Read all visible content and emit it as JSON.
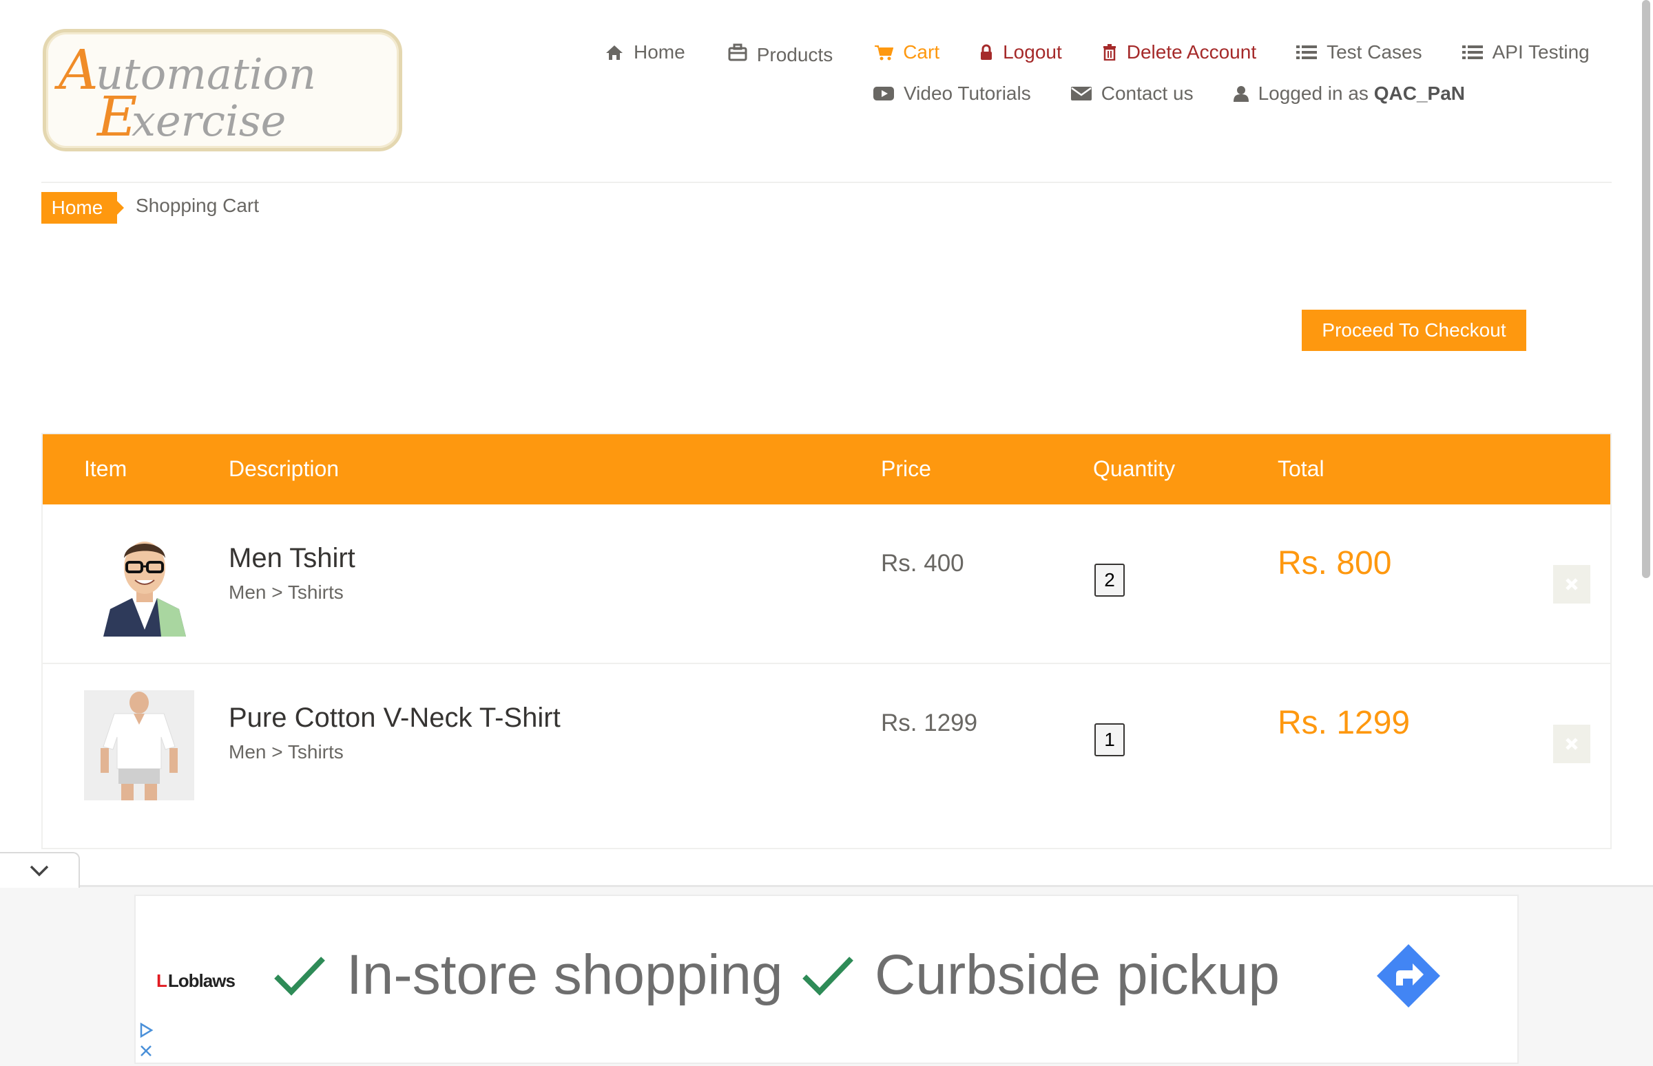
{
  "logo": {
    "line1": "Automation",
    "line2": "Exercise"
  },
  "nav": {
    "row1": [
      {
        "icon": "home-icon",
        "label": "Home"
      },
      {
        "icon": "briefcase-icon",
        "label": "Products"
      },
      {
        "icon": "cart-icon",
        "label": "Cart",
        "active": true
      },
      {
        "icon": "lock-icon",
        "label": "Logout"
      },
      {
        "icon": "trash-icon",
        "label": "Delete Account"
      },
      {
        "icon": "list-icon",
        "label": "Test Cases"
      },
      {
        "icon": "list-icon",
        "label": "API Testing"
      }
    ],
    "row2": [
      {
        "icon": "youtube-icon",
        "label": "Video Tutorials"
      },
      {
        "icon": "envelope-icon",
        "label": "Contact us"
      },
      {
        "icon": "user-icon",
        "label": "Logged in as",
        "username": "QAC_PaN"
      }
    ]
  },
  "breadcrumb": {
    "home": "Home",
    "current": "Shopping Cart"
  },
  "checkout_label": "Proceed To Checkout",
  "cart": {
    "headers": {
      "item": "Item",
      "description": "Description",
      "price": "Price",
      "quantity": "Quantity",
      "total": "Total"
    },
    "rows": [
      {
        "name": "Men Tshirt",
        "category": "Men > Tshirts",
        "price": "Rs. 400",
        "quantity": "2",
        "total": "Rs. 800"
      },
      {
        "name": "Pure Cotton V-Neck T-Shirt",
        "category": "Men > Tshirts",
        "price": "Rs. 1299",
        "quantity": "1",
        "total": "Rs. 1299"
      }
    ]
  },
  "ad": {
    "brand": "Loblaws",
    "brand_mark": "L",
    "feature1": "In-store shopping",
    "feature2": "Curbside pickup",
    "check_color": "#2e8b57",
    "go_color": "#4285f4"
  },
  "colors": {
    "accent": "#fe980f",
    "danger": "#a52a2a"
  }
}
